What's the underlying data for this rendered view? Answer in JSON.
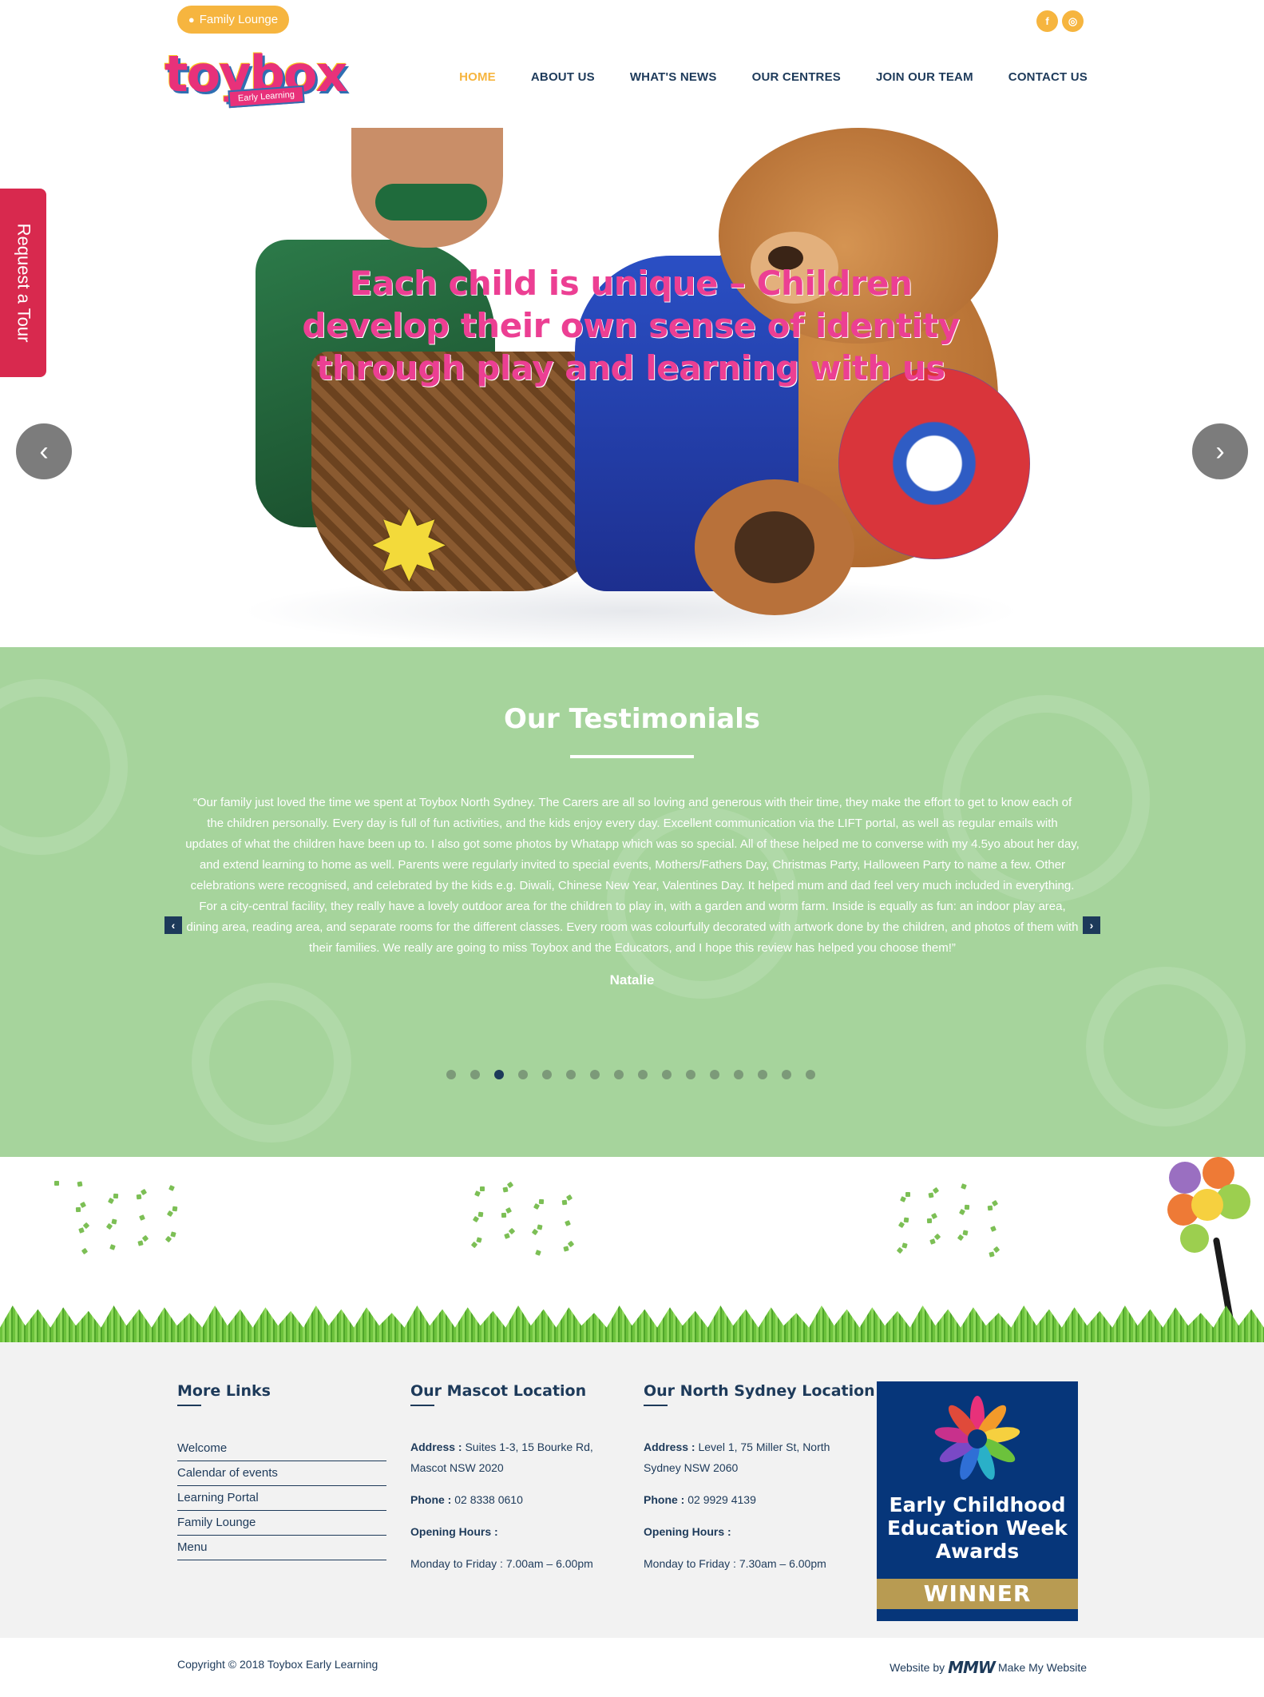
{
  "header": {
    "family_lounge_label": "Family Lounge",
    "logo_word": "toybox",
    "logo_tagline": "Early Learning",
    "social": {
      "facebook_glyph": "f",
      "instagram_glyph": "◎"
    },
    "nav": [
      "HOME",
      "ABOUT US",
      "WHAT'S NEWS",
      "OUR CENTRES",
      "JOIN OUR TEAM",
      "CONTACT US"
    ],
    "active_nav": "HOME"
  },
  "hero": {
    "caption": "Each child is unique – Children develop their own sense of identity through play and learning with us",
    "prev_glyph": "‹",
    "next_glyph": "›"
  },
  "request_tour": {
    "label": "Request a Tour"
  },
  "testimonials": {
    "title": "Our Testimonials",
    "quote": "“Our family just loved the time we spent at Toybox North Sydney. The Carers are all so loving and generous with their time, they make the effort to get to know each of the children personally. Every day is full of fun activities, and the kids enjoy every day. Excellent communication via the LIFT portal, as well as regular emails with updates of what the children have been up to. I also got some photos by Whatapp which was so special. All of these helped me to converse with my 4.5yo about her day, and extend learning to home as well. Parents were regularly invited to special events, Mothers/Fathers Day, Christmas Party, Halloween Party to name a few. Other celebrations were recognised, and celebrated by the kids e.g. Diwali, Chinese New Year, Valentines Day. It helped mum and dad feel very much included in everything. For a city-central facility, they really have a lovely outdoor area for the children to play in, with a garden and worm farm. Inside is equally as fun: an indoor play area, dining area, reading area, and separate rooms for the different classes. Every room was colourfully decorated with artwork done by the children, and photos of them with their families. We really are going to miss Toybox and the Educators, and I hope this review has helped you choose them!”",
    "author": "Natalie",
    "prev_glyph": "‹",
    "next_glyph": "›",
    "dot_count": 16,
    "active_dot": 3
  },
  "footer": {
    "more_links": {
      "title": "More Links",
      "items": [
        "Welcome",
        "Calendar of events",
        "Learning Portal",
        "Family Lounge",
        "Menu"
      ]
    },
    "mascot": {
      "title": "Our Mascot Location",
      "address_label": "Address :",
      "address": " Suites 1-3, 15 Bourke Rd, Mascot NSW 2020",
      "phone_label": "Phone :",
      "phone": " 02 8338 0610",
      "hours_label": "Opening Hours :",
      "hours": "Monday to Friday : 7.00am – 6.00pm"
    },
    "north_sydney": {
      "title": "Our North Sydney Location",
      "address_label": "Address :",
      "address": " Level 1, 75 Miller St, North Sydney NSW 2060",
      "phone_label": "Phone :",
      "phone": " 02 9929 4139",
      "hours_label": "Opening Hours :",
      "hours": "Monday to Friday : 7.30am – 6.00pm"
    },
    "award": {
      "title": "Early Childhood Education Week Awards",
      "badge": "WINNER"
    }
  },
  "bottom": {
    "copyright": "Copyright © 2018 Toybox Early Learning",
    "website_by": "Website by",
    "mmw_logo": "MMW",
    "mmw_name": "Make My Website"
  },
  "colors": {
    "accent_orange": "#f6b53f",
    "navy": "#1d3a5a",
    "pink": "#ec3f93",
    "testimonial_green": "#a6d49c",
    "tour_red": "#d8294e",
    "award_blue": "#06367a",
    "award_gold": "#b89b52"
  }
}
